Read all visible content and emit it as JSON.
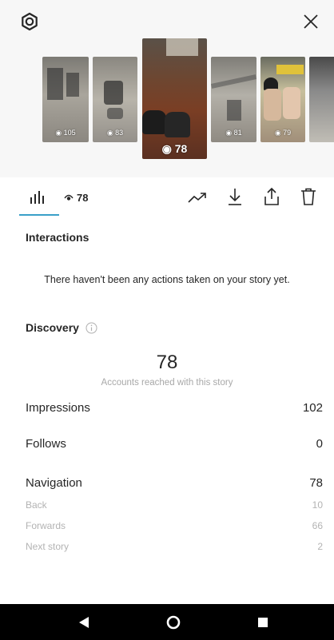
{
  "header": {
    "settings_icon": "gear-icon",
    "close_icon": "close-icon"
  },
  "thumbnails": [
    {
      "views": "◉ 105"
    },
    {
      "views": "◉ 83"
    },
    {
      "views": "◉ 78",
      "selected": true
    },
    {
      "views": "◉ 81"
    },
    {
      "views": "◉ 79"
    },
    {
      "views": ""
    }
  ],
  "tabs": {
    "insights_icon": "bar-chart-icon",
    "viewers_count": "78"
  },
  "actions": {
    "promote_icon": "trending-up-icon",
    "download_icon": "download-icon",
    "share_icon": "share-icon",
    "delete_icon": "trash-icon"
  },
  "interactions": {
    "title": "Interactions",
    "empty_message": "There haven't been any actions taken on your story yet."
  },
  "discovery": {
    "title": "Discovery",
    "info_icon": "info-icon",
    "reach_value": "78",
    "reach_caption": "Accounts reached with this story",
    "rows": [
      {
        "label": "Impressions",
        "value": "102"
      },
      {
        "label": "Follows",
        "value": "0"
      },
      {
        "label": "Navigation",
        "value": "78"
      }
    ],
    "sub_rows": [
      {
        "label": "Back",
        "value": "10"
      },
      {
        "label": "Forwards",
        "value": "66"
      },
      {
        "label": "Next story",
        "value": "2"
      }
    ]
  },
  "system_nav": {
    "back_icon": "back-triangle-icon",
    "home_icon": "home-circle-icon",
    "recents_icon": "recents-square-icon"
  },
  "colors": {
    "accent": "#3aa0c8",
    "top_background": "#f7f7f7",
    "muted_text": "#a8a8a8"
  }
}
